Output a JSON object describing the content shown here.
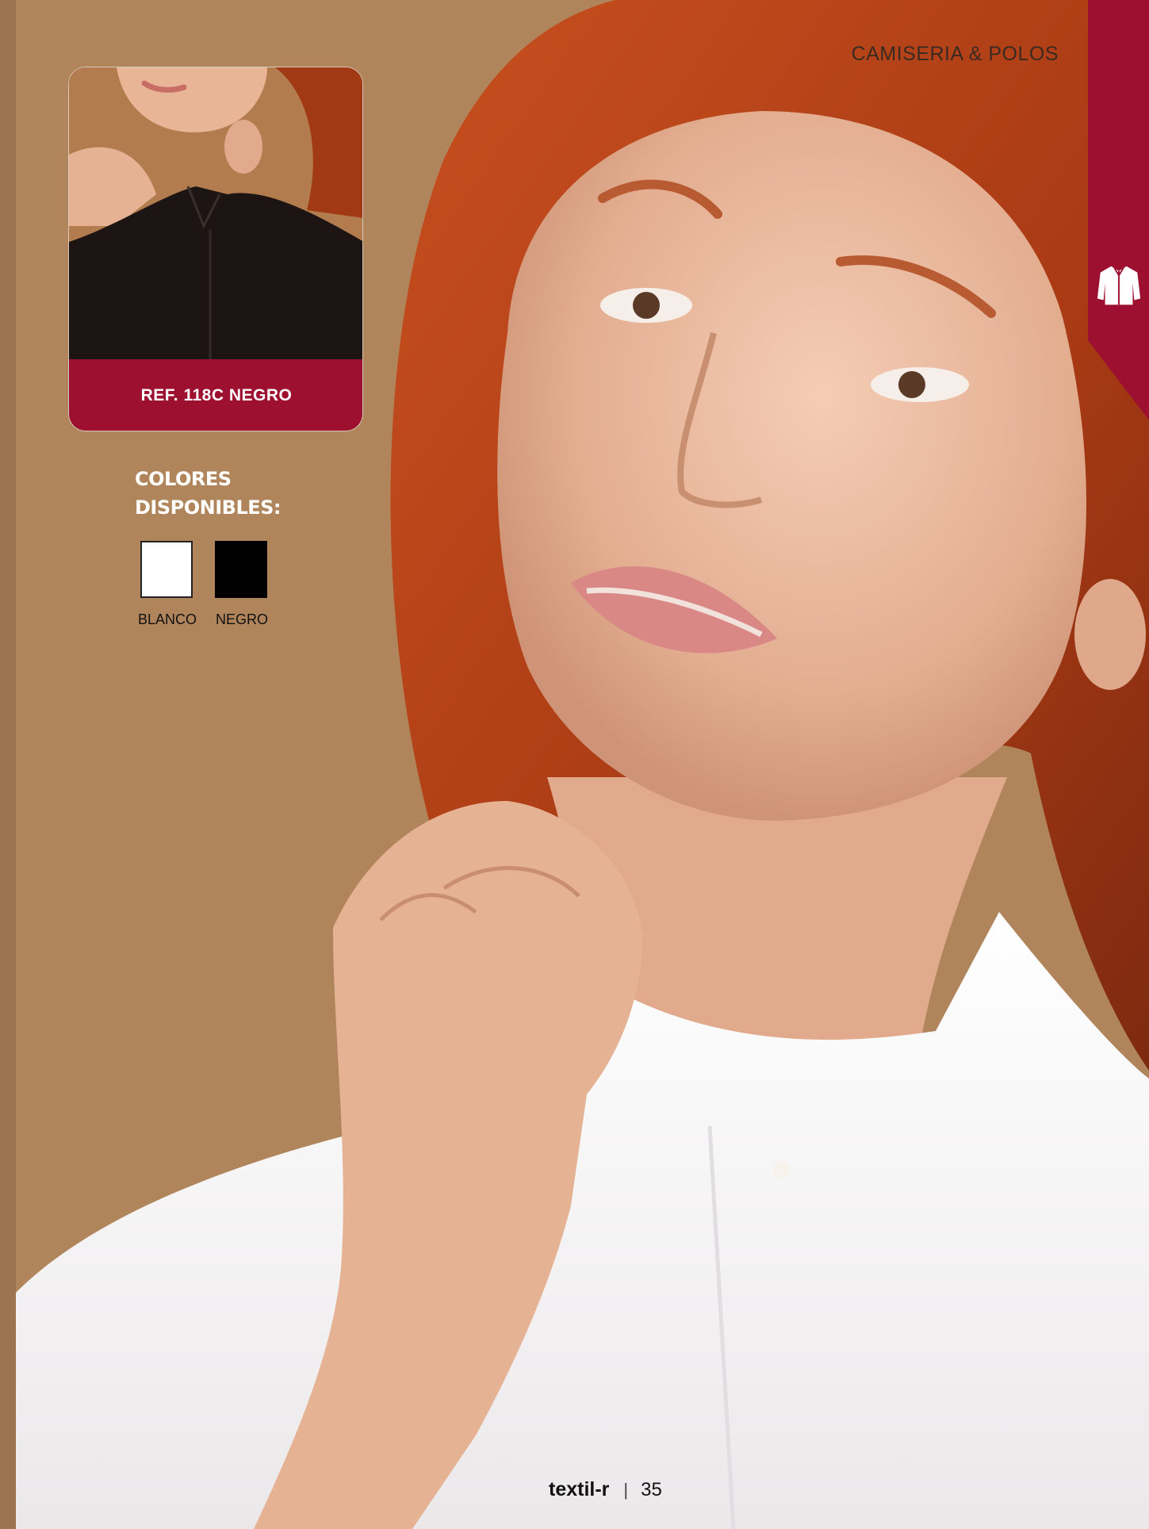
{
  "header": {
    "section_title": "CAMISERIA & POLOS",
    "tab_icon": "shirt-icon",
    "tab_color": "#9e1030"
  },
  "product": {
    "reference": "REF. 118C NEGRO"
  },
  "colors": {
    "heading_line1": "COLORES",
    "heading_line2": "DISPONIBLES:",
    "options": [
      {
        "name": "BLANCO",
        "hex": "#ffffff"
      },
      {
        "name": "NEGRO",
        "hex": "#000000"
      }
    ]
  },
  "footer": {
    "brand": "textil-r",
    "separator": "|",
    "page_number": "35"
  }
}
